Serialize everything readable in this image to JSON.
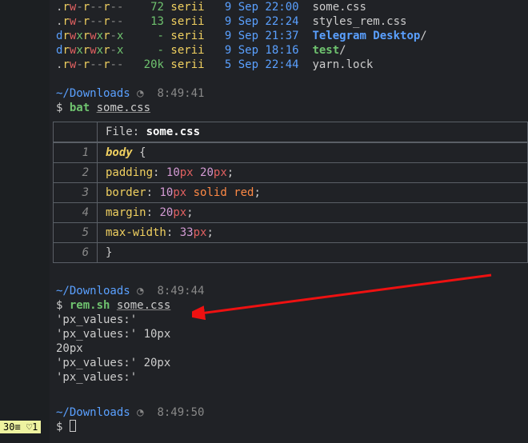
{
  "listing": [
    {
      "perm": [
        ".",
        "r",
        "w",
        "-",
        "r",
        "-",
        "-",
        "r",
        "-",
        "-"
      ],
      "size": "72",
      "user": "serii",
      "date": "9 Sep 22:00",
      "name": "some.css",
      "type": "file"
    },
    {
      "perm": [
        ".",
        "r",
        "w",
        "-",
        "r",
        "-",
        "-",
        "r",
        "-",
        "-"
      ],
      "size": "13",
      "user": "serii",
      "date": "9 Sep 22:24",
      "name": "styles_rem.css",
      "type": "file"
    },
    {
      "perm": [
        "d",
        "r",
        "w",
        "x",
        "r",
        "w",
        "x",
        "r",
        "-",
        "x"
      ],
      "size": "-",
      "user": "serii",
      "date": "9 Sep 21:37",
      "name": "Telegram Desktop",
      "type": "dir"
    },
    {
      "perm": [
        "d",
        "r",
        "w",
        "x",
        "r",
        "w",
        "x",
        "r",
        "-",
        "x"
      ],
      "size": "-",
      "user": "serii",
      "date": "9 Sep 18:16",
      "name": "test",
      "type": "dirx"
    },
    {
      "perm": [
        ".",
        "r",
        "w",
        "-",
        "r",
        "-",
        "-",
        "r",
        "-",
        "-"
      ],
      "size": "20k",
      "user": "serii",
      "date": "5 Sep 22:44",
      "name": "yarn.lock",
      "type": "file"
    }
  ],
  "prompt1": {
    "path": "~/Downloads",
    "time": "8:49:41",
    "cmd": "bat",
    "arg": "some.css"
  },
  "bat": {
    "file_label": "File: ",
    "file_name": "some.css",
    "lines": [
      {
        "n": "1",
        "html": "<span class='sel'>body</span> <span class='punc'>{</span>"
      },
      {
        "n": "2",
        "html": "  <span class='kw'>padding</span><span class='punc'>:</span> <span class='num'>10</span><span class='unit'>px</span> <span class='num'>20</span><span class='unit'>px</span><span class='punc'>;</span>"
      },
      {
        "n": "3",
        "html": "  <span class='kw'>border</span><span class='punc'>:</span> <span class='num'>10</span><span class='unit'>px</span> <span class='ident'>solid</span> <span class='ident'>red</span><span class='punc'>;</span>"
      },
      {
        "n": "4",
        "html": "  <span class='kw'>margin</span><span class='punc'>:</span> <span class='num'>20</span><span class='unit'>px</span><span class='punc'>;</span>"
      },
      {
        "n": "5",
        "html": "  <span class='kw'>max-width</span><span class='punc'>:</span> <span class='num'>33</span><span class='unit'>px</span><span class='punc'>;</span>"
      },
      {
        "n": "6",
        "html": "  <span class='punc'>}</span>"
      }
    ]
  },
  "prompt2": {
    "path": "~/Downloads",
    "time": "8:49:44",
    "cmd": "rem.sh",
    "arg": "some.css"
  },
  "output": [
    "'px_values:'",
    "'px_values:' 10px",
    "20px",
    "'px_values:' 20px",
    "'px_values:'"
  ],
  "prompt3": {
    "path": "~/Downloads",
    "time": "8:49:50"
  },
  "status": "30≡ ♡1",
  "clock": "◔"
}
